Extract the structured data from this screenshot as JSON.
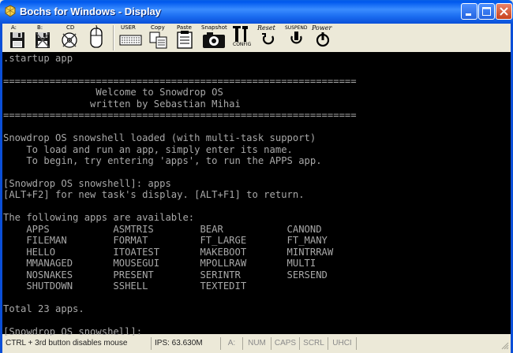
{
  "window": {
    "title": "Bochs for Windows - Display",
    "icon": "bochs-app-icon",
    "controls": [
      "minimize-icon",
      "maximize-icon",
      "close-icon"
    ]
  },
  "toolbar": {
    "floppy_a_label": "A:",
    "floppy_b_label": "B:",
    "cdrom_label": "CD",
    "mouse_label": "",
    "user_label": "USER",
    "copy_label": "Copy",
    "paste_label": "Paste",
    "snapshot_label": "Snapshot",
    "config_label": "CONFIG",
    "reset_label": "Reset",
    "suspend_label": "SUSPEND",
    "power_label": "Power"
  },
  "console": {
    "lines": [
      ".startup app",
      "",
      "=============================================================",
      "                Welcome to Snowdrop OS",
      "               written by Sebastian Mihai",
      "=============================================================",
      "",
      "Snowdrop OS snowshell loaded (with multi-task support)",
      "    To load and run an app, simply enter its name.",
      "    To begin, try entering 'apps', to run the APPS app.",
      "",
      "[Snowdrop OS snowshell]: apps",
      "[ALT+F2] for new task's display. [ALT+F1] to return.",
      "",
      "The following apps are available:",
      "    APPS           ASMTRIS        BEAR           CANOND",
      "    FILEMAN        FORMAT         FT_LARGE       FT_MANY",
      "    HELLO          ITOATEST       MAKEBOOT       MINTRRAW",
      "    MMANAGED       MOUSEGUI       MPOLLRAW       MULTI",
      "    NOSNAKES       PRESENT        SERINTR        SERSEND",
      "    SHUTDOWN       SSHELL         TEXTEDIT",
      "",
      "Total 23 apps.",
      "",
      "[Snowdrop OS snowshell]: "
    ]
  },
  "statusbar": {
    "hint": "CTRL + 3rd button disables mouse",
    "ips": "IPS: 63.630M",
    "drive": "A:",
    "num": "NUM",
    "caps": "CAPS",
    "scrl": "SCRL",
    "uhci": "UHCI"
  },
  "colors": {
    "console_text": "#a8a8a8",
    "console_bg": "#000000",
    "titlebar": "#0a5fe6",
    "chrome": "#ece9d8"
  }
}
